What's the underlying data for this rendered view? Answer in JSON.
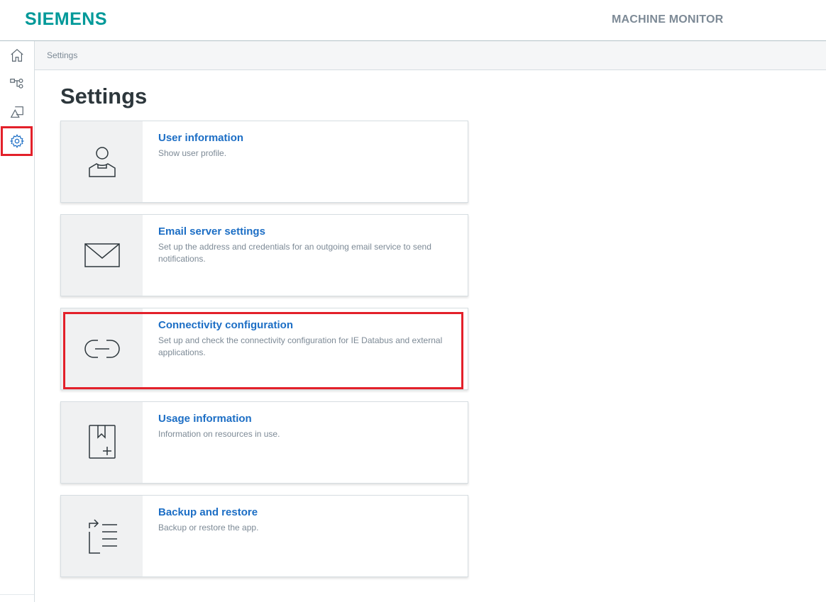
{
  "header": {
    "logo": "SIEMENS",
    "app_title": "MACHINE MONITOR"
  },
  "sidebar": {
    "items": [
      {
        "icon": "home-icon",
        "active": false
      },
      {
        "icon": "flow-icon",
        "active": false
      },
      {
        "icon": "shapes-icon",
        "active": false
      },
      {
        "icon": "gear-icon",
        "active": true
      }
    ]
  },
  "breadcrumb": "Settings",
  "page": {
    "title": "Settings",
    "cards": [
      {
        "title": "User information",
        "desc": "Show user profile.",
        "icon": "user-icon"
      },
      {
        "title": "Email server settings",
        "desc": "Set up the address and credentials for an outgoing email service to send notifications.",
        "icon": "envelope-icon"
      },
      {
        "title": "Connectivity configuration",
        "desc": "Set up and check the connectivity configuration for IE Databus and external applications.",
        "icon": "link-icon"
      },
      {
        "title": "Usage information",
        "desc": "Information on resources in use.",
        "icon": "bookmark-plus-icon"
      },
      {
        "title": "Backup and restore",
        "desc": "Backup or restore the app.",
        "icon": "backup-restore-icon"
      }
    ]
  },
  "colors": {
    "brand": "#009999",
    "link": "#1c6ec5",
    "highlight": "#e3202a"
  }
}
